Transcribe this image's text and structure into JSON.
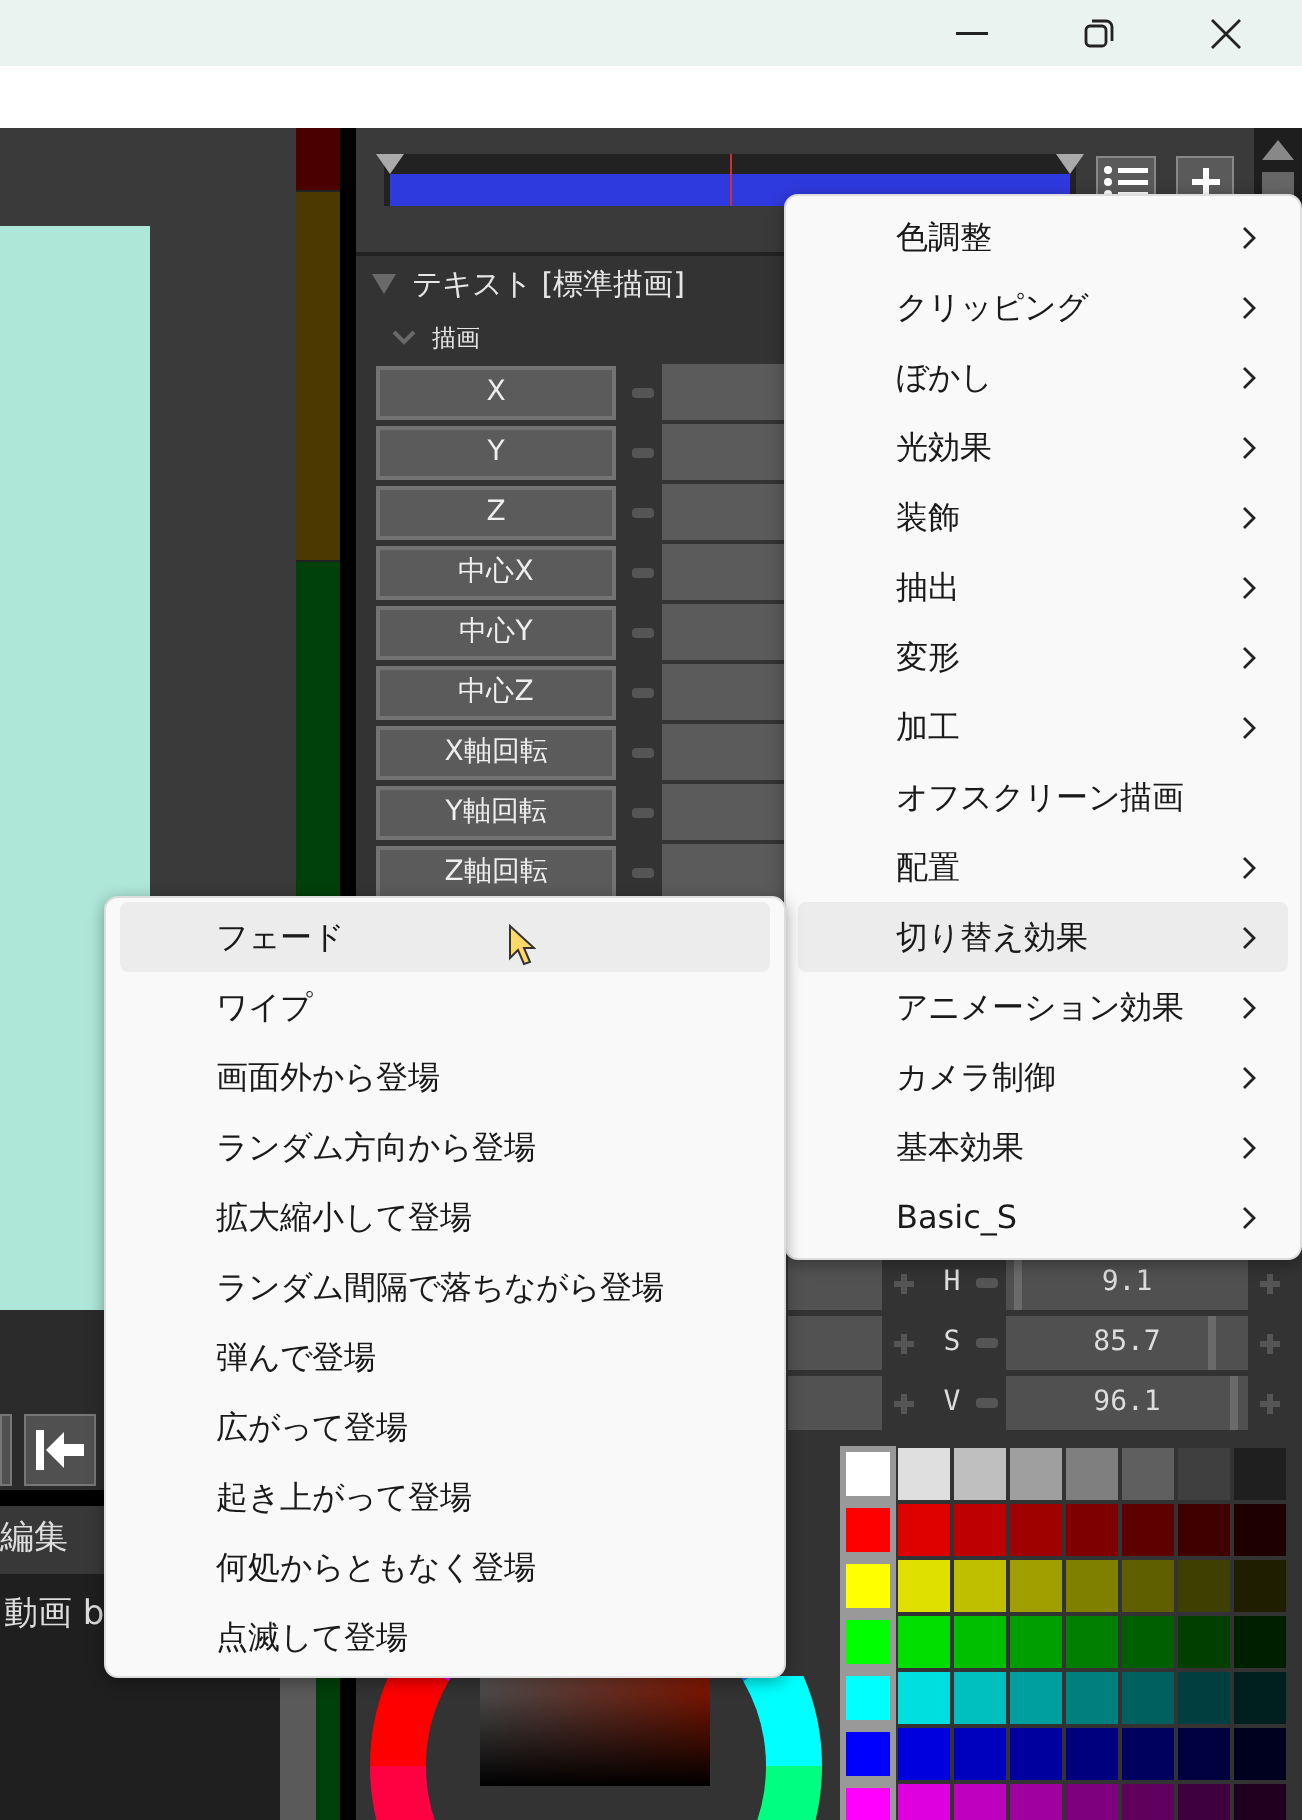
{
  "section": {
    "title": "テキスト [標準描画]",
    "expanded": true
  },
  "group": {
    "title": "描画",
    "expanded": true
  },
  "params": [
    "X",
    "Y",
    "Z",
    "中心X",
    "中心Y",
    "中心Z",
    "X軸回転",
    "Y軸回転",
    "Z軸回転"
  ],
  "hsv": [
    {
      "label": "H",
      "value": "9.1",
      "level": 0.03
    },
    {
      "label": "S",
      "value": "85.7",
      "level": 0.86
    },
    {
      "label": "V",
      "value": "96.1",
      "level": 0.96
    }
  ],
  "palette": [
    [
      {
        "color": "#ffffff"
      },
      {
        "color": "#dfdfdf"
      },
      {
        "color": "#bfbfbf"
      },
      {
        "color": "#9f9f9f"
      },
      {
        "color": "#7f7f7f"
      },
      {
        "color": "#5f5f5f"
      },
      {
        "color": "#3f3f3f"
      },
      {
        "color": "#1f1f1f"
      }
    ],
    [
      {
        "color": "#ff0000"
      },
      {
        "color": "#df0000"
      },
      {
        "color": "#bf0000"
      },
      {
        "color": "#9f0000"
      },
      {
        "color": "#7f0000"
      },
      {
        "color": "#5f0000"
      },
      {
        "color": "#3f0000"
      },
      {
        "color": "#1f0000"
      }
    ],
    [
      {
        "color": "#ffff00"
      },
      {
        "color": "#dfdf00"
      },
      {
        "color": "#bfbf00"
      },
      {
        "color": "#9f9f00"
      },
      {
        "color": "#7f7f00"
      },
      {
        "color": "#5f5f00"
      },
      {
        "color": "#3f3f00"
      },
      {
        "color": "#1f1f00"
      }
    ],
    [
      {
        "color": "#00ff00"
      },
      {
        "color": "#00df00"
      },
      {
        "color": "#00bf00"
      },
      {
        "color": "#009f00"
      },
      {
        "color": "#007f00"
      },
      {
        "color": "#005f00"
      },
      {
        "color": "#003f00"
      },
      {
        "color": "#001f00"
      }
    ],
    [
      {
        "color": "#00ffff"
      },
      {
        "color": "#00dfdf"
      },
      {
        "color": "#00bfbf"
      },
      {
        "color": "#009f9f"
      },
      {
        "color": "#007f7f"
      },
      {
        "color": "#005f5f"
      },
      {
        "color": "#003f3f"
      },
      {
        "color": "#001f1f"
      }
    ],
    [
      {
        "color": "#0000ff"
      },
      {
        "color": "#0000df"
      },
      {
        "color": "#0000bf"
      },
      {
        "color": "#00009f"
      },
      {
        "color": "#00007f"
      },
      {
        "color": "#00005f"
      },
      {
        "color": "#00003f"
      },
      {
        "color": "#00001f"
      }
    ],
    [
      {
        "color": "#ff00ff"
      },
      {
        "color": "#df00df"
      },
      {
        "color": "#bf00bf"
      },
      {
        "color": "#9f009f"
      },
      {
        "color": "#7f007f"
      },
      {
        "color": "#5f005f"
      },
      {
        "color": "#3f003f"
      },
      {
        "color": "#1f001f"
      }
    ]
  ],
  "bottom_left": {
    "tab": "編集",
    "text": "動画 b"
  },
  "menu": [
    {
      "label": "色調整",
      "submenu": true,
      "selected": false
    },
    {
      "label": "クリッピング",
      "submenu": true,
      "selected": false
    },
    {
      "label": "ぼかし",
      "submenu": true,
      "selected": false
    },
    {
      "label": "光効果",
      "submenu": true,
      "selected": false
    },
    {
      "label": "装飾",
      "submenu": true,
      "selected": false
    },
    {
      "label": "抽出",
      "submenu": true,
      "selected": false
    },
    {
      "label": "変形",
      "submenu": true,
      "selected": false
    },
    {
      "label": "加工",
      "submenu": true,
      "selected": false
    },
    {
      "label": "オフスクリーン描画",
      "submenu": false,
      "selected": false
    },
    {
      "label": "配置",
      "submenu": true,
      "selected": false
    },
    {
      "label": "切り替え効果",
      "submenu": true,
      "selected": true
    },
    {
      "label": "アニメーション効果",
      "submenu": true,
      "selected": false
    },
    {
      "label": "カメラ制御",
      "submenu": true,
      "selected": false
    },
    {
      "label": "基本効果",
      "submenu": true,
      "selected": false
    },
    {
      "label": "Basic_S",
      "submenu": true,
      "selected": false
    }
  ],
  "submenu": [
    {
      "label": "フェード",
      "selected": true
    },
    {
      "label": "ワイプ",
      "selected": false
    },
    {
      "label": "画面外から登場",
      "selected": false
    },
    {
      "label": "ランダム方向から登場",
      "selected": false
    },
    {
      "label": "拡大縮小して登場",
      "selected": false
    },
    {
      "label": "ランダム間隔で落ちながら登場",
      "selected": false
    },
    {
      "label": "弾んで登場",
      "selected": false
    },
    {
      "label": "広がって登場",
      "selected": false
    },
    {
      "label": "起き上がって登場",
      "selected": false
    },
    {
      "label": "何処からともなく登場",
      "selected": false
    },
    {
      "label": "点滅して登場",
      "selected": false
    }
  ]
}
